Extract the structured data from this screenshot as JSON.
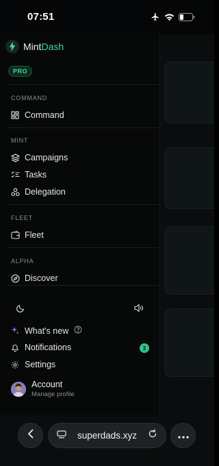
{
  "status_bar": {
    "time": "07:51"
  },
  "brand": {
    "name_main": "Mint",
    "name_accent": "Dash",
    "badge": "PRO"
  },
  "sections": [
    {
      "label": "COMMAND",
      "items": [
        {
          "label": "Command",
          "icon": "dashboard-grid-icon"
        }
      ]
    },
    {
      "label": "MINT",
      "items": [
        {
          "label": "Campaigns",
          "icon": "layers-icon"
        },
        {
          "label": "Tasks",
          "icon": "checklist-icon"
        },
        {
          "label": "Delegation",
          "icon": "network-icon"
        }
      ]
    },
    {
      "label": "FLEET",
      "items": [
        {
          "label": "Fleet",
          "icon": "wallet-icon"
        }
      ]
    },
    {
      "label": "ALPHA",
      "items": [
        {
          "label": "Discover",
          "icon": "compass-icon"
        }
      ]
    }
  ],
  "footer": {
    "whats_new": "What's new",
    "notifications": "Notifications",
    "notifications_count": "3",
    "settings": "Settings",
    "account_name": "Account",
    "account_sub": "Manage profile"
  },
  "browser": {
    "url": "superdads.xyz"
  },
  "colors": {
    "accent": "#3ddc97",
    "badge": "#2ec486",
    "background": "#070808"
  }
}
